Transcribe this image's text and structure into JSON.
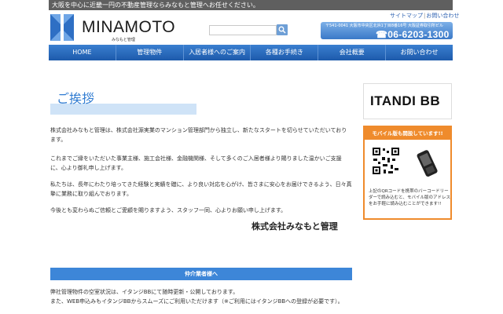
{
  "header": {
    "tagline": "大阪を中心に近畿一円の不動産管理ならみなもと管理へお任せください。",
    "logo_text": "MINAMOTO",
    "logo_sub": "みなもと管理",
    "sitemap_link": "サイトマップ",
    "inquiry_link": "お問い合わせ",
    "contact_address": "〒541-0041 大阪市中央区北浜1丁目8番16号 大阪証券取引所ビル",
    "phone": "☎06-6203-1300",
    "search_value": ""
  },
  "nav": {
    "items": [
      {
        "label": "HOME"
      },
      {
        "label": "管理物件"
      },
      {
        "label": "入居者様へのご案内"
      },
      {
        "label": "各種お手続き"
      },
      {
        "label": "会社概要"
      },
      {
        "label": "お問い合わせ"
      }
    ]
  },
  "main": {
    "heading": "ご挨拶",
    "paragraphs": [
      "株式会社みなもと管理は、株式会社源実業のマンション管理部門から独立し、新たなスタートを切らせていただいております。",
      "これまでご縁をいただいた事業主様、施工会社様、金融機関様、そして多くのご入居者様より賜りました温かいご支援に、心より御礼申し上げます。",
      "私たちは、長年にわたり培ってきた経験と実績を礎に、より良い対応を心がけ、皆さまに安心をお届けできるよう、日々真摯に業務に取り組んでおります。",
      "今後とも変わらぬご信頼とご愛顧を賜りますよう、スタッフ一同、心よりお願い申し上げます。"
    ],
    "signature": "株式会社みなもと管理",
    "section_title": "仲介業者様へ",
    "section_lines": [
      "弊社管理物件の空室状況は、イタンジBBにて随時更新・公開しております。",
      "また、WEB申込みもイタンジBBからスムーズにご利用いただけます（※ご利用にはイタンジBBへの登録が必要です）。"
    ]
  },
  "sidebar": {
    "banner_text": "ITANDI BB",
    "mobile_title": "モバイル版も開設しています!!",
    "mobile_text": "上記のQRコードを携帯のバーコードリーダーで読み込むと、モバイル版のアドレスをお手軽に読み込むことができます!!"
  },
  "colors": {
    "nav_blue": "#2b6cc0",
    "accent_blue": "#2f7bd1",
    "orange": "#ef8b2c",
    "topbar_gray": "#5f5f5f"
  }
}
